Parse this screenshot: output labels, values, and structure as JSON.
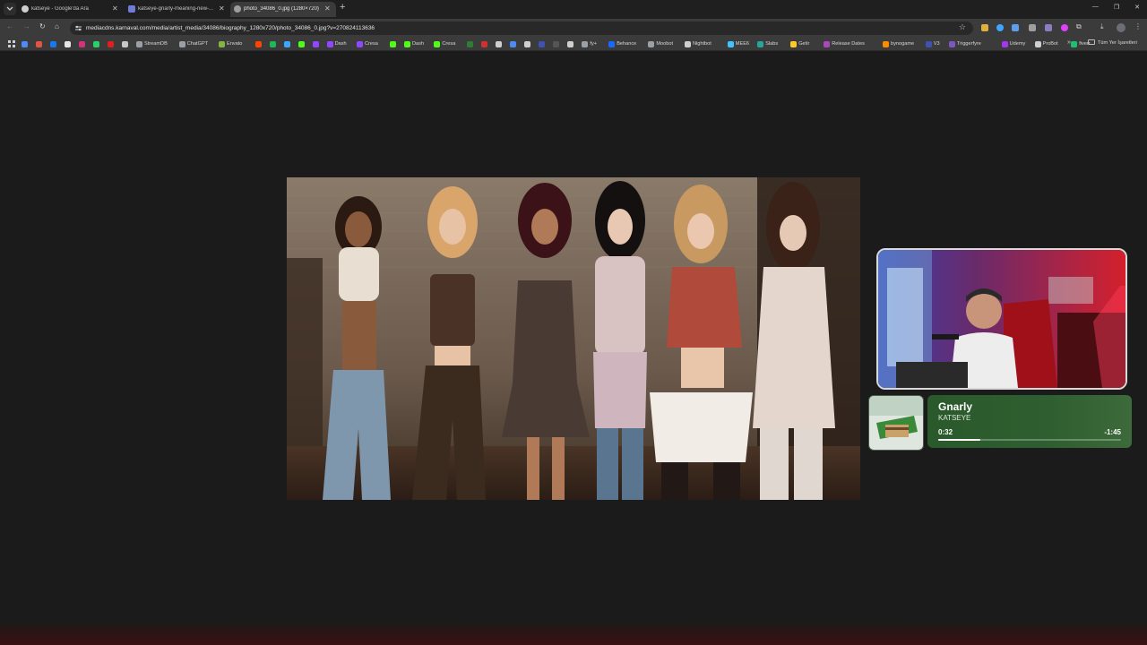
{
  "browser": {
    "tabs": [
      {
        "title": "katseye - Google'da Ara",
        "favicon": "google-icon",
        "active": false
      },
      {
        "title": "katseye-gnarly-meaning-new-...",
        "favicon": "site-icon",
        "active": false
      },
      {
        "title": "photo_34086_0.jpg (1280×720)",
        "favicon": "image-icon",
        "active": true
      }
    ],
    "address": {
      "url": "mediacdns.karnaval.com/media/artist_media/34086/biography_1280x720/photo_34086_0.jpg?v=270824113636"
    },
    "bookmarks": [
      {
        "label": "",
        "icon": "chrome-icon",
        "color": "#4c8bf5"
      },
      {
        "label": "",
        "icon": "mail-icon",
        "color": "#e1553f"
      },
      {
        "label": "",
        "icon": "facebook-icon",
        "color": "#1877f2"
      },
      {
        "label": "",
        "icon": "x-icon",
        "color": "#e6e6e6"
      },
      {
        "label": "",
        "icon": "instagram-icon",
        "color": "#d6307a"
      },
      {
        "label": "",
        "icon": "whatsapp-icon",
        "color": "#25d366"
      },
      {
        "label": "",
        "icon": "youtube-icon",
        "color": "#e02020"
      },
      {
        "label": "",
        "icon": "send-icon",
        "color": "#c7c7c7"
      },
      {
        "label": "StreamDB",
        "icon": "streamdb-icon",
        "color": "#9aa0a6"
      },
      {
        "label": "ChatGPT",
        "icon": "chatgpt-icon",
        "color": "#9aa0a6"
      },
      {
        "label": "Envato",
        "icon": "envato-icon",
        "color": "#82b541"
      },
      {
        "label": "",
        "icon": "reddit-icon",
        "color": "#ff4500"
      },
      {
        "label": "",
        "icon": "spotify-icon",
        "color": "#1db954"
      },
      {
        "label": "",
        "icon": "check-icon",
        "color": "#3ea6ff"
      },
      {
        "label": "",
        "icon": "kick-icon",
        "color": "#53fc18"
      },
      {
        "label": "",
        "icon": "twitch-icon",
        "color": "#9146ff"
      },
      {
        "label": "Dash",
        "icon": "twitch-icon",
        "color": "#9146ff"
      },
      {
        "label": "Cresa",
        "icon": "twitch-icon",
        "color": "#9146ff"
      },
      {
        "label": "",
        "icon": "kick-icon",
        "color": "#53fc18"
      },
      {
        "label": "Dash",
        "icon": "kick-icon",
        "color": "#53fc18"
      },
      {
        "label": "Cresa",
        "icon": "kick-icon",
        "color": "#53fc18"
      },
      {
        "label": "",
        "icon": "dot-icon",
        "color": "#2e7d32"
      },
      {
        "label": "",
        "icon": "record-icon",
        "color": "#d32f2f"
      },
      {
        "label": "",
        "icon": "grid-icon",
        "color": "#cfcfcf"
      },
      {
        "label": "",
        "icon": "circle-icon",
        "color": "#4c8bf5"
      },
      {
        "label": "",
        "icon": "bar-icon",
        "color": "#cfcfcf"
      },
      {
        "label": "",
        "icon": "b-icon",
        "color": "#3f51b5"
      },
      {
        "label": "",
        "icon": "square-icon",
        "color": "#555555"
      },
      {
        "label": "",
        "icon": "wp-icon",
        "color": "#cfcfcf"
      },
      {
        "label": "fy+",
        "icon": "fy-icon",
        "color": "#9aa0a6"
      },
      {
        "label": "Behance",
        "icon": "behance-icon",
        "color": "#1769ff"
      },
      {
        "label": "Moobot",
        "icon": "moobot-icon",
        "color": "#9aa0a6"
      },
      {
        "label": "Nightbot",
        "icon": "nightbot-icon",
        "color": "#cfcfcf"
      },
      {
        "label": "MEE6",
        "icon": "mee6-icon",
        "color": "#40c4ff"
      },
      {
        "label": "Slabs",
        "icon": "slabs-icon",
        "color": "#26a69a"
      },
      {
        "label": "Getir",
        "icon": "getir-icon",
        "color": "#ffca28"
      },
      {
        "label": "Release Dates",
        "icon": "release-icon",
        "color": "#ab47bc"
      },
      {
        "label": "bynogame",
        "icon": "bynogame-icon",
        "color": "#fb8c00"
      },
      {
        "label": "V3",
        "icon": "v3-icon",
        "color": "#3f51b5"
      },
      {
        "label": "Triggerfyre",
        "icon": "triggerfyre-icon",
        "color": "#7e57c2"
      },
      {
        "label": "Udemy",
        "icon": "udemy-icon",
        "color": "#a435f0"
      },
      {
        "label": "ProBot",
        "icon": "probot-icon",
        "color": "#cfcfcf"
      },
      {
        "label": "fiverr",
        "icon": "fiverr-icon",
        "color": "#1dbf73"
      }
    ],
    "bookmarks_other": "Tüm Yer İşaretleri"
  },
  "now_playing": {
    "title": "Gnarly",
    "artist": "KATSEYE",
    "elapsed": "0:32",
    "remaining": "-1:45",
    "progress": 0.23
  },
  "colors": {
    "page_bg": "#1b1b1b",
    "player_green": "#2f5e30",
    "tabstrip": "#1f1f1f",
    "toolbar": "#3b3b3b"
  }
}
